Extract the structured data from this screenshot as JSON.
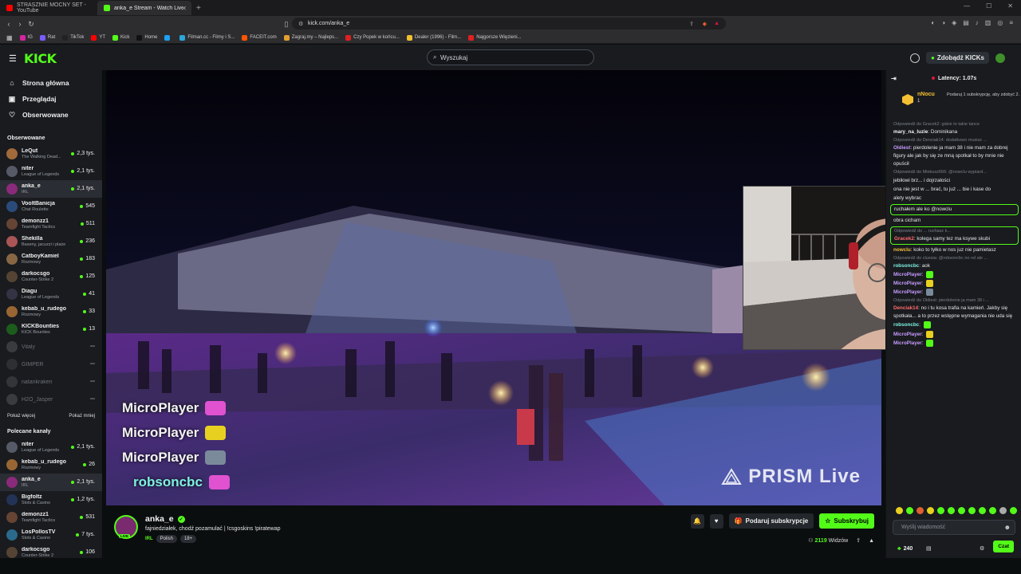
{
  "browser": {
    "tabs": [
      {
        "label": "STRASZNIE MOCNY SET - YouTube",
        "color": "#ff0000",
        "active": false
      },
      {
        "label": "anka_e Stream - Watch Live o",
        "color": "#53fc18",
        "active": true
      }
    ],
    "new_tab": "+",
    "url": "kick.com/anka_e",
    "bookmarks": [
      {
        "label": "IG",
        "color": "#d6249f"
      },
      {
        "label": "Rat",
        "color": "#7a5cff"
      },
      {
        "label": "TikTok",
        "color": "#222222"
      },
      {
        "label": "YT",
        "color": "#ff0000"
      },
      {
        "label": "Kick",
        "color": "#53fc18"
      },
      {
        "label": "Home",
        "color": "#111111"
      },
      {
        "label": "",
        "color": "#1da1f2"
      },
      {
        "label": "Filman.cc - Filmy i S...",
        "color": "#2aa7d9"
      },
      {
        "label": "FACEIT.com",
        "color": "#ff5500"
      },
      {
        "label": "Zagraj.my – Najleps...",
        "color": "#e0a030"
      },
      {
        "label": "Czy Popek w końcu...",
        "color": "#e02020"
      },
      {
        "label": "Dealer (1996) - Film...",
        "color": "#f0c030"
      },
      {
        "label": "Najgorsze Więzieni...",
        "color": "#e02020"
      }
    ]
  },
  "header": {
    "logo": "KICK",
    "search_placeholder": "Wyszukaj",
    "get_kicks": "Zdobądź KICKs"
  },
  "sidebar": {
    "nav": [
      {
        "label": "Strona główna",
        "icon": "home-icon",
        "glyph": "⌂"
      },
      {
        "label": "Przeglądaj",
        "icon": "browse-icon",
        "glyph": "▣"
      },
      {
        "label": "Obserwowane",
        "icon": "heart-icon",
        "glyph": "♡"
      }
    ],
    "followed_title": "Obserwowane",
    "followed": [
      {
        "name": "LeQut",
        "category": "The Walking Dead...",
        "viewers": "2,3 tys.",
        "color": "#a06a3a"
      },
      {
        "name": "niter",
        "category": "League of Legends",
        "viewers": "2,1 tys.",
        "color": "#555a66"
      },
      {
        "name": "anka_e",
        "category": "IRL",
        "viewers": "2,1 tys.",
        "color": "#8a2a7a",
        "selected": true
      },
      {
        "name": "VooltBanicja",
        "category": "Chat Roulette",
        "viewers": "545",
        "color": "#2a4a7a"
      },
      {
        "name": "demonzz1",
        "category": "Teamfight Tactics",
        "viewers": "511",
        "color": "#664433"
      },
      {
        "name": "Shekilla",
        "category": "Baseny, jacuzzi i plaże",
        "viewers": "236",
        "color": "#aa5555"
      },
      {
        "name": "CatboyKamiel",
        "category": "Rozmowy",
        "viewers": "183",
        "color": "#886644"
      },
      {
        "name": "darkocsgo",
        "category": "Counter-Strike 2",
        "viewers": "125",
        "color": "#554433"
      },
      {
        "name": "Diagu",
        "category": "League of Legends",
        "viewers": "41",
        "color": "#333344"
      },
      {
        "name": "kebab_u_rudego",
        "category": "Rozmowy",
        "viewers": "33",
        "color": "#996633"
      },
      {
        "name": "KICKBounties",
        "category": "KICK Bounties",
        "viewers": "13",
        "color": "#1c5c1c"
      }
    ],
    "offline": [
      {
        "name": "Vitaly",
        "color": "#777777"
      },
      {
        "name": "GIMPER",
        "color": "#555555"
      },
      {
        "name": "natankraken",
        "color": "#666666"
      },
      {
        "name": "H2O_Jasper",
        "color": "#777777"
      }
    ],
    "show_more": "Pokaż więcej",
    "show_less": "Pokaż mniej",
    "recommended_title": "Polecane kanały",
    "recommended": [
      {
        "name": "niter",
        "category": "League of Legends",
        "viewers": "2,1 tys.",
        "color": "#555a66"
      },
      {
        "name": "kebab_u_rudego",
        "category": "Rozmowy",
        "viewers": "26",
        "color": "#996633"
      },
      {
        "name": "anka_e",
        "category": "IRL",
        "viewers": "2,1 tys.",
        "color": "#8a2a7a",
        "selected": true
      },
      {
        "name": "Bigfoltz",
        "category": "Slots & Casino",
        "viewers": "1,2 tys.",
        "color": "#223355"
      },
      {
        "name": "demonzz1",
        "category": "Teamfight Tactics",
        "viewers": "531",
        "color": "#664433"
      },
      {
        "name": "LosPollosTV",
        "category": "Slots & Casino",
        "viewers": "7 tys.",
        "color": "#2a6a8a"
      },
      {
        "name": "darkocsgo",
        "category": "Counter-Strike 2",
        "viewers": "106",
        "color": "#554433"
      }
    ]
  },
  "video": {
    "overlay_names": [
      {
        "name": "MicroPlayer",
        "emote_color": "#e052d0"
      },
      {
        "name": "MicroPlayer",
        "emote_color": "#e8d020"
      },
      {
        "name": "MicroPlayer",
        "emote_color": "#7a8a9a"
      },
      {
        "name": "robsoncbc",
        "emote_color": "#e052d0"
      }
    ],
    "watermark": "PRISM Live"
  },
  "stream": {
    "streamer": "anka_e",
    "live_label": "LIVE",
    "title": "fajniedziałek, chodź pozamulać | !csgoskins !piratewap",
    "category": "IRL",
    "tags": [
      "Polish",
      "18+"
    ],
    "gift_subs": "Podaruj subskrypcje",
    "subscribe": "Subskrybuj",
    "viewer_count": "2119",
    "viewers_label": "Widzów"
  },
  "chat": {
    "latency": "Latency: 1.07s",
    "pinned_user": "nNocu",
    "pinned_count": "1",
    "pinned_text": "Podaruj 1 subskrypcję, aby zdobyć 2.",
    "messages": [
      {
        "reply": "Odpowiedź do Gracek2: gdzie to takie tance",
        "user": "mary_na_luzie",
        "user_color": "#f2f2f2",
        "text": "Dominikana"
      },
      {
        "reply": "Odpowiedź do Denciak14: dodatkowo musisz ...",
        "user": "Oldiest",
        "user_color": "#c89cff",
        "text": "pierdolenie ja mam 38 i nie mam za dobrej figury ale jak by się ze mną spotkał to by mnie nie opuścił"
      },
      {
        "reply": "Odpowiedź do Miekusz666: @nowclu wypiard...",
        "user": "",
        "user_color": "#f2f2f2",
        "text": ""
      },
      {
        "reply": "",
        "user": "",
        "user_color": "#f2f2f2",
        "text": "jebiłowi brz... i dojrzałości"
      },
      {
        "reply": "",
        "user": "",
        "user_color": "#f2f2f2",
        "text": "ona nie jest w ... brać, tu już ... bie i kase do"
      },
      {
        "reply": "",
        "user": "",
        "user_color": "#f2f2f2",
        "text": "alety wybrac"
      },
      {
        "reply": "",
        "user": "",
        "user_color": "#f2f2f2",
        "text": "ruchałem ale ko @nowclu",
        "highlight": true
      },
      {
        "reply": "",
        "user": "",
        "user_color": "#f2f2f2",
        "text": "obra cicham"
      },
      {
        "reply": "Odpowiedź do ... ruchasz k...",
        "user": "Gracek2",
        "user_color": "#ff6b6b",
        "text": "kolega samy tez ma ksywe skubi",
        "highlight": true
      },
      {
        "reply": "",
        "user": "nowclu",
        "user_color": "#f4c033",
        "text": "koko to tyłko w nos juz nie pamietasz"
      },
      {
        "reply": "Odpowiedź do cluesia: @robsoncbc no rel ale ...",
        "user": "robsoncbc",
        "user_color": "#7ef0e0",
        "text": "aok"
      },
      {
        "reply": "",
        "user": "MicroPlayer",
        "user_color": "#c89cff",
        "text": "",
        "emote": "#53fc18"
      },
      {
        "reply": "",
        "user": "MicroPlayer",
        "user_color": "#c89cff",
        "text": "",
        "emote": "#e8d020"
      },
      {
        "reply": "",
        "user": "MicroPlayer",
        "user_color": "#c89cff",
        "text": "",
        "emote": "#7a8a9a"
      },
      {
        "reply": "Odpowiedź do Oldiest: pierdolenie ja mam 38 i ...",
        "user": "Denciak14",
        "user_color": "#ff6b6b",
        "text": "no i tu kosa trafia na kamień. Jakby się spotkała... a to przez wstępne wymagania nie uda się"
      },
      {
        "reply": "",
        "user": "robsoncbc",
        "user_color": "#7ef0e0",
        "text": "",
        "emote": "#53fc18"
      },
      {
        "reply": "",
        "user": "MicroPlayer",
        "user_color": "#c89cff",
        "text": "",
        "emote": "#e8d020"
      },
      {
        "reply": "",
        "user": "MicroPlayer",
        "user_color": "#c89cff",
        "text": "",
        "emote": "#53fc18"
      }
    ],
    "quick_emotes": [
      "#e8d020",
      "#53fc18",
      "#e06030",
      "#e8d020",
      "#53fc18",
      "#53fc18",
      "#53fc18",
      "#53fc18",
      "#53fc18",
      "#53fc18",
      "#aaaaaa",
      "#53fc18"
    ],
    "input_placeholder": "Wyślij wiadomość",
    "points": "240",
    "send": "Czat"
  }
}
